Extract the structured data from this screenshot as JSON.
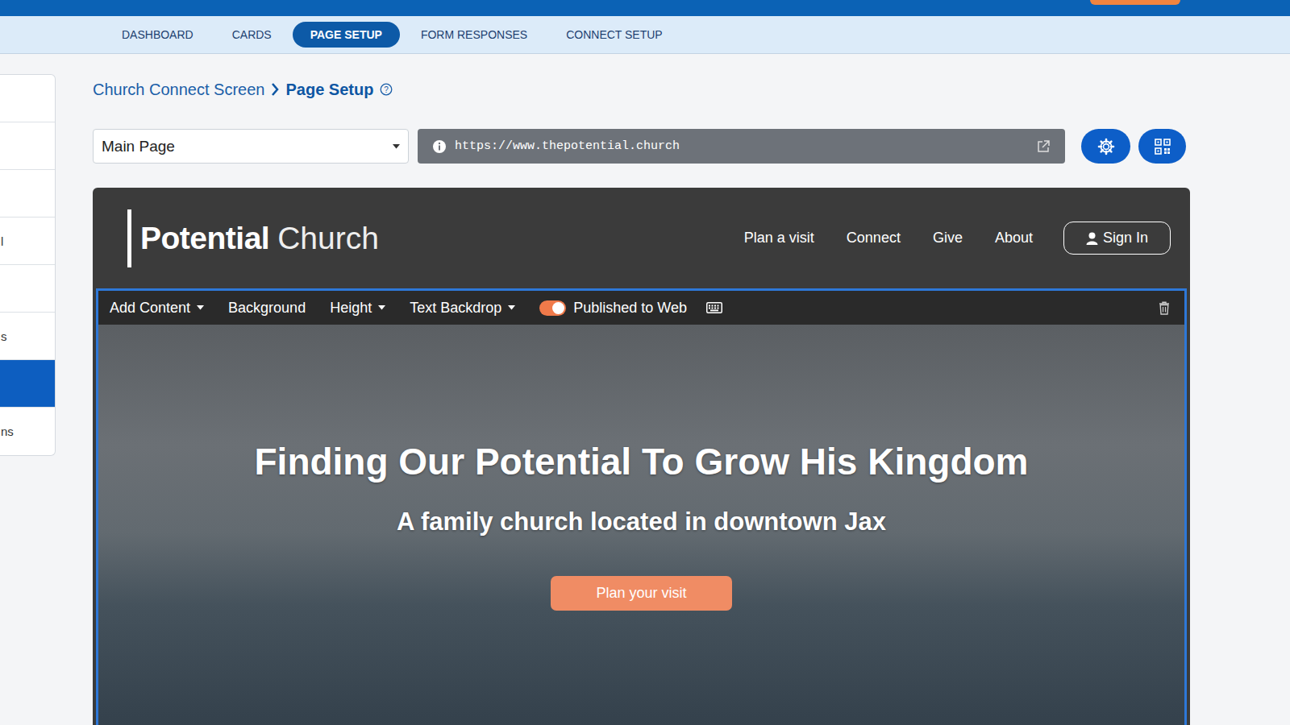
{
  "nav": {
    "tabs": [
      {
        "label": "DASHBOARD",
        "selected": false
      },
      {
        "label": "CARDS",
        "selected": false
      },
      {
        "label": "PAGE SETUP",
        "selected": true
      },
      {
        "label": "FORM RESPONSES",
        "selected": false
      },
      {
        "label": "CONNECT SETUP",
        "selected": false
      }
    ]
  },
  "sidebar": {
    "items": [
      {
        "label": "",
        "selected": false
      },
      {
        "label": "",
        "selected": false
      },
      {
        "label": "",
        "selected": false
      },
      {
        "label": "l",
        "selected": false
      },
      {
        "label": "",
        "selected": false
      },
      {
        "label": "s",
        "selected": false
      },
      {
        "label": "",
        "selected": true
      },
      {
        "label": "ns",
        "selected": false
      }
    ]
  },
  "breadcrumb": {
    "parent": "Church Connect Screen",
    "current": "Page Setup"
  },
  "page_select": {
    "value": "Main Page"
  },
  "url": "https://www.thepotential.church",
  "preview": {
    "logo": {
      "bold": "Potential",
      "light": "Church"
    },
    "nav": [
      "Plan a visit",
      "Connect",
      "Give",
      "About"
    ],
    "sign_in": "Sign In",
    "toolbar": {
      "items": [
        {
          "label": "Add Content",
          "has_menu": true
        },
        {
          "label": "Background",
          "has_menu": false
        },
        {
          "label": "Height",
          "has_menu": true
        },
        {
          "label": "Text Backdrop",
          "has_menu": true
        }
      ],
      "published": {
        "label": "Published to Web",
        "on": true
      }
    },
    "hero": {
      "title": "Finding Our Potential To Grow His Kingdom",
      "subtitle": "A family church located in downtown Jax",
      "button": "Plan your visit"
    }
  }
}
